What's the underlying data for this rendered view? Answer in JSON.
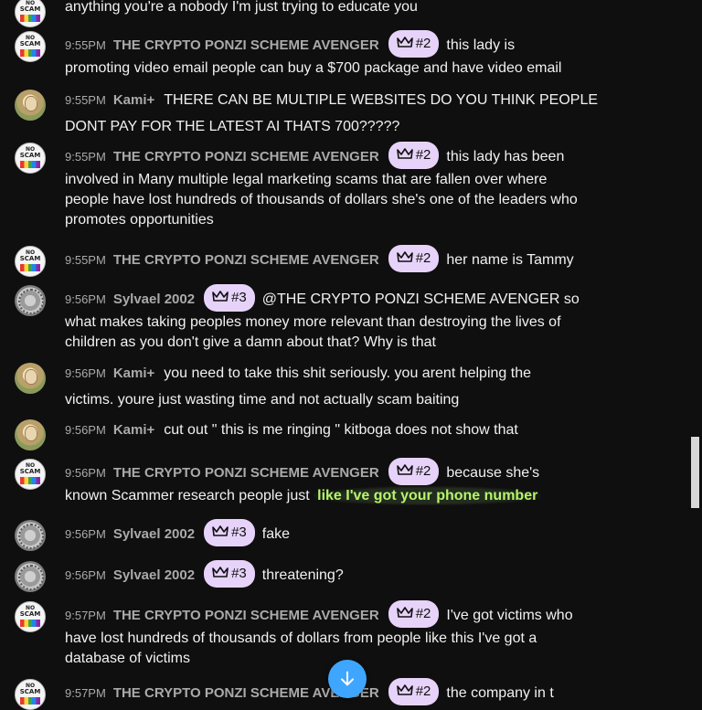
{
  "colors": {
    "background": "#0f0f0f",
    "badge": "#e7d3f9",
    "highlight": "#b6f56b",
    "scroll_button": "#3ea6ff"
  },
  "icons": {
    "badge_icon": "crown-icon",
    "scroll_button_icon": "arrow-down-icon"
  },
  "messages": [
    {
      "avatar": "noscam",
      "lines": [
        {
          "text": "anything you're a nobody I'm just trying to educate you"
        }
      ]
    },
    {
      "avatar": "noscam",
      "time": "9:55PM",
      "author": "THE CRYPTO PONZI SCHEME AVENGER",
      "badge": "#2",
      "lines": [
        {
          "text": "this lady is"
        },
        {
          "text": "promoting video email people can buy a $700 package and have video email"
        }
      ]
    },
    {
      "avatar": "kami",
      "time": "9:55PM",
      "author": "Kami+",
      "lines": [
        {
          "text": "THERE CAN BE MULTIPLE WEBSITES DO YOU THINK PEOPLE"
        },
        {
          "text": "DONT PAY FOR THE LATEST AI THATS 700?????"
        }
      ]
    },
    {
      "avatar": "noscam",
      "time": "9:55PM",
      "author": "THE CRYPTO PONZI SCHEME AVENGER",
      "badge": "#2",
      "lines": [
        {
          "text": "this lady has been"
        },
        {
          "text": "involved in Many multiple legal marketing scams that are fallen over where"
        },
        {
          "text": "people have lost hundreds of thousands of dollars she's one of the leaders who"
        },
        {
          "text": "promotes opportunities"
        }
      ]
    },
    {
      "avatar": "noscam",
      "time": "9:55PM",
      "author": "THE CRYPTO PONZI SCHEME AVENGER",
      "badge": "#2",
      "lines": [
        {
          "text": "her name is Tammy"
        }
      ]
    },
    {
      "avatar": "sylv",
      "time": "9:56PM",
      "author": "Sylvael 2002",
      "badge": "#3",
      "lines": [
        {
          "text": "@THE CRYPTO PONZI SCHEME AVENGER so"
        },
        {
          "text": "what makes taking peoples money more relevant than destroying the lives of"
        },
        {
          "text": "children as you don't give a damn about that? Why is that"
        }
      ]
    },
    {
      "avatar": "kami",
      "time": "9:56PM",
      "author": "Kami+",
      "lines": [
        {
          "text": "you need to take this shit seriously. you arent helping the"
        },
        {
          "text": "victims. youre just wasting time and not actually scam baiting"
        }
      ]
    },
    {
      "avatar": "kami",
      "time": "9:56PM",
      "author": "Kami+",
      "lines": [
        {
          "text": "cut out \" this is me ringing \" kitboga does not show that"
        }
      ]
    },
    {
      "avatar": "noscam",
      "time": "9:56PM",
      "author": "THE CRYPTO PONZI SCHEME AVENGER",
      "badge": "#2",
      "lines": [
        {
          "text": "because she's"
        },
        {
          "text": "known Scammer research people just",
          "highlight": "like I've got your phone number"
        }
      ]
    },
    {
      "avatar": "sylv",
      "time": "9:56PM",
      "author": "Sylvael 2002",
      "badge": "#3",
      "lines": [
        {
          "text": "fake"
        }
      ]
    },
    {
      "avatar": "sylv",
      "time": "9:56PM",
      "author": "Sylvael 2002",
      "badge": "#3",
      "lines": [
        {
          "text": "threatening?"
        }
      ]
    },
    {
      "avatar": "noscam",
      "time": "9:57PM",
      "author": "THE CRYPTO PONZI SCHEME AVENGER",
      "badge": "#2",
      "lines": [
        {
          "text": "I've got victims who"
        },
        {
          "text": "have lost hundreds of thousands of dollars from people like this I've got a"
        },
        {
          "text": "database of victims"
        }
      ]
    },
    {
      "avatar": "noscam",
      "time": "9:57PM",
      "author": "THE CRYPTO PONZI SCHEME AVENGER",
      "badge": "#2",
      "lines": [
        {
          "text": "the company in t"
        }
      ]
    }
  ],
  "avatar_text": {
    "line1": "NO",
    "line2": "SCAM"
  }
}
